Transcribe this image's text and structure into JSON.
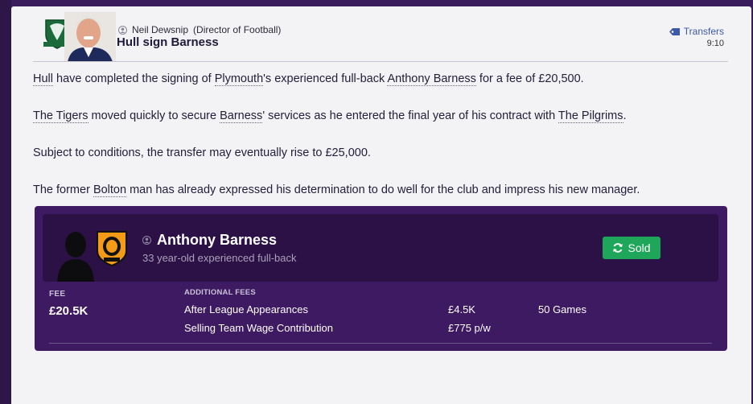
{
  "news": {
    "author_name": "Neil Dewsnip",
    "author_role": "(Director of Football)",
    "headline": "Hull sign Barness",
    "category": "Transfers",
    "time": "9:10"
  },
  "body": {
    "p1": {
      "a": "Hull",
      "b": " have completed the signing of ",
      "c": "Plymouth",
      "d": "'s experienced full-back ",
      "e": "Anthony Barness",
      "f": " for a fee of £20,500."
    },
    "p2": {
      "a": "The Tigers",
      "b": " moved quickly to secure ",
      "c": "Barness",
      "d": "' services as he entered the final year of his contract with ",
      "e": "The Pilgrims",
      "f": "."
    },
    "p3": "Subject to conditions, the transfer may eventually rise to £25,000.",
    "p4": {
      "a": "The former ",
      "b": "Bolton",
      "c": " man has already expressed his determination to do well for the club and impress his new manager."
    }
  },
  "transfer_card": {
    "player_name": "Anthony Barness",
    "player_description": "33 year-old experienced full-back",
    "status_button": "Sold",
    "fee_label": "FEE",
    "fee_value": "£20.5K",
    "additional_fees_label": "ADDITIONAL FEES",
    "additional_fees": [
      {
        "condition": "After League Appearances",
        "amount": "£4.5K",
        "detail": "50 Games"
      },
      {
        "condition": "Selling Team Wage Contribution",
        "amount": "£775 p/w",
        "detail": ""
      }
    ]
  },
  "colors": {
    "accent_link": "#3d5aa8",
    "card_background": "#3d1a62",
    "sold_green": "#1ea65a"
  },
  "icons": [
    "person-icon",
    "tag-icon",
    "refresh-icon",
    "club-crest-icon",
    "player-silhouette-icon"
  ]
}
